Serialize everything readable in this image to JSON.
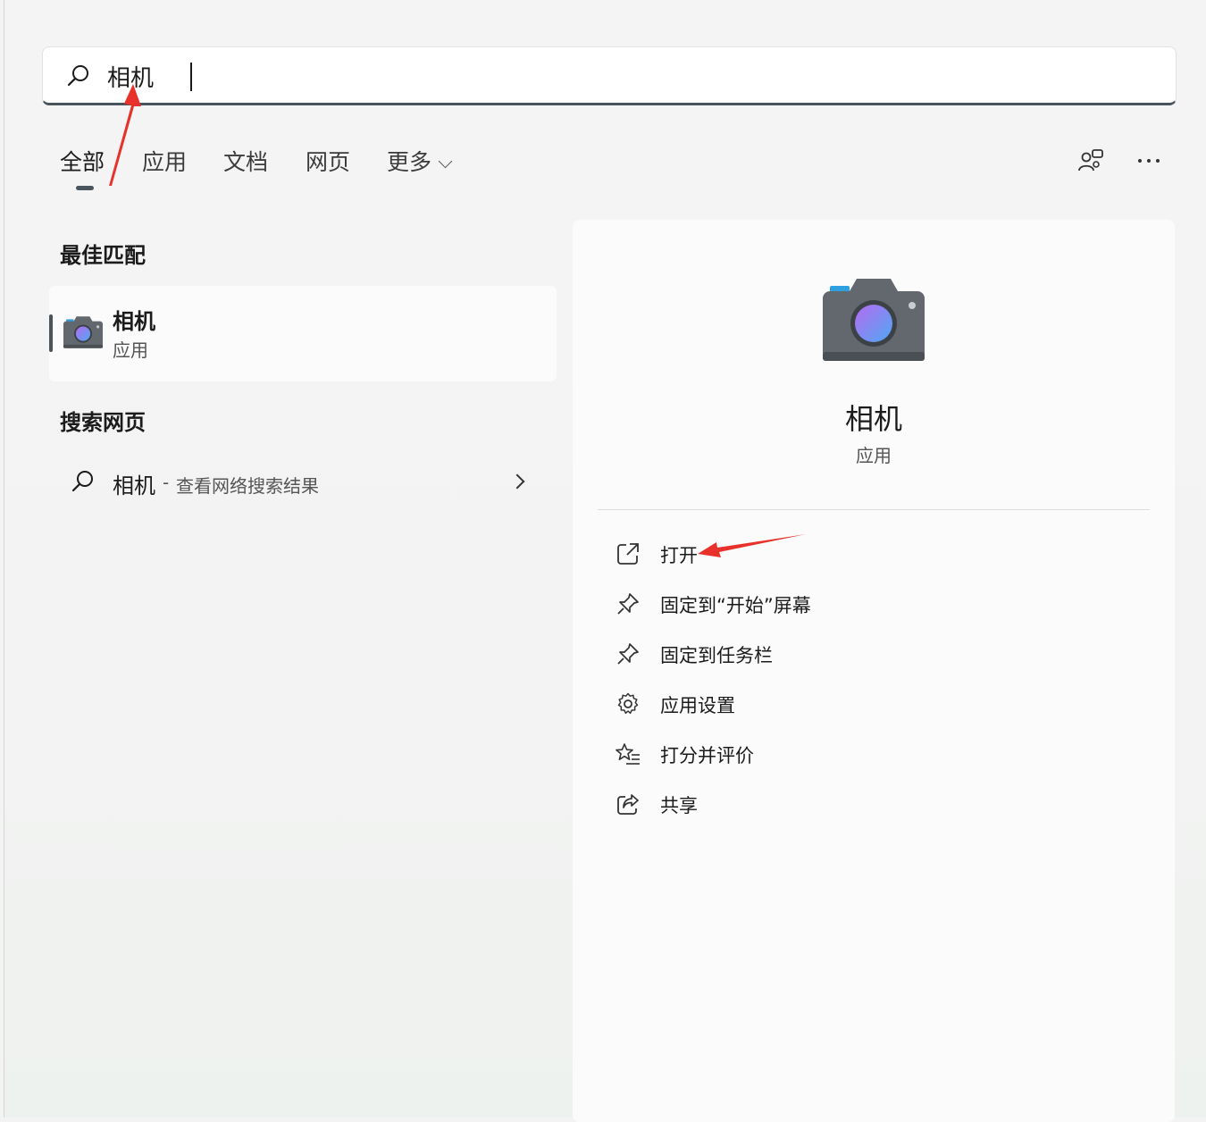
{
  "search": {
    "value": "相机"
  },
  "tabs": [
    {
      "label": "全部"
    },
    {
      "label": "应用"
    },
    {
      "label": "文档"
    },
    {
      "label": "网页"
    },
    {
      "label": "更多"
    }
  ],
  "best_match": {
    "heading": "最佳匹配",
    "name": "相机",
    "type": "应用"
  },
  "web_search": {
    "heading": "搜索网页",
    "query": "相机",
    "separator": "-",
    "description": "查看网络搜索结果"
  },
  "detail": {
    "title": "相机",
    "subtitle": "应用",
    "actions": [
      {
        "label": "打开",
        "icon": "open-external-icon"
      },
      {
        "label": "固定到“开始”屏幕",
        "icon": "pin-icon"
      },
      {
        "label": "固定到任务栏",
        "icon": "pin-icon"
      },
      {
        "label": "应用设置",
        "icon": "gear-icon"
      },
      {
        "label": "打分并评价",
        "icon": "star-list-icon"
      },
      {
        "label": "共享",
        "icon": "share-icon"
      }
    ]
  },
  "colors": {
    "accent": "#4a545d",
    "annotation_arrow": "#e8312b"
  }
}
